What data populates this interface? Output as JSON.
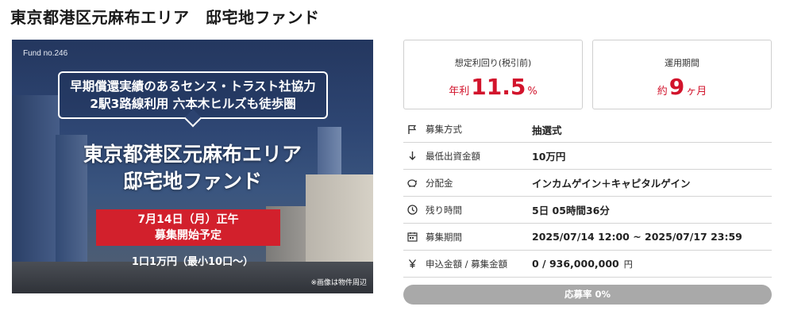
{
  "page_title": "東京都港区元麻布エリア　邸宅地ファンド",
  "banner": {
    "fund_no": "Fund no.246",
    "callout_lines": [
      "早期償還実績のあるセンス・トラスト社協力",
      "2駅3路線利用 六本木ヒルズも徒歩圏"
    ],
    "title_lines": [
      "東京都港区元麻布エリア",
      "邸宅地ファンド"
    ],
    "date_lines": [
      "7月14日（月）正午",
      "募集開始予定"
    ],
    "unit_text": "1口1万円（最小10口〜）",
    "note": "※画像は物件周辺"
  },
  "yield_box": {
    "label": "想定利回り(税引前)",
    "prefix": "年利",
    "value": "11.5",
    "suffix": "%"
  },
  "term_box": {
    "label": "運用期間",
    "prefix": "約",
    "value": "9",
    "suffix": "ヶ月"
  },
  "rows": [
    {
      "icon": "flag-icon",
      "label": "募集方式",
      "value": "抽選式"
    },
    {
      "icon": "arrow-down-icon",
      "label": "最低出資金額",
      "value": "10万円"
    },
    {
      "icon": "piggy-bank-icon",
      "label": "分配金",
      "value": "インカムゲイン＋キャピタルゲイン"
    },
    {
      "icon": "clock-icon",
      "label": "残り時間",
      "value": "5日 05時間36分"
    },
    {
      "icon": "calendar-icon",
      "label": "募集期間",
      "value": "2025/07/14 12:00 ~ 2025/07/17 23:59"
    },
    {
      "icon": "yen-icon",
      "label": "申込金額 / 募集金額",
      "value": "0 / 936,000,000",
      "unit": "円"
    }
  ],
  "progress": {
    "label": "応募率 0%",
    "percent": 0
  },
  "colors": {
    "accent": "#d2142c",
    "progress_bg": "#a9a9a9",
    "banner_red": "#d2202c"
  }
}
